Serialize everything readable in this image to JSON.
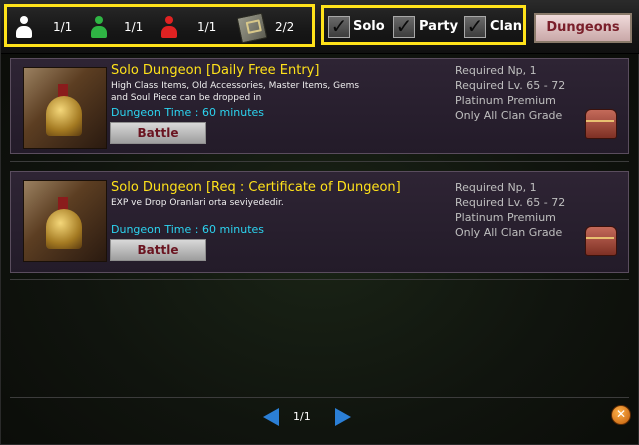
{
  "header": {
    "counts": [
      {
        "color": "#ffffff",
        "value": "1/1"
      },
      {
        "color": "#2fb544",
        "value": "1/1"
      },
      {
        "color": "#e02222",
        "value": "1/1"
      },
      {
        "icon": "letter-icon",
        "value": "2/2"
      }
    ],
    "filters": [
      {
        "label": "Solo",
        "checked": true
      },
      {
        "label": "Party",
        "checked": true
      },
      {
        "label": "Clan",
        "checked": true
      }
    ],
    "dungeons_label": "Dungeons"
  },
  "dungeons": [
    {
      "title": "Solo Dungeon [Daily Free Entry]",
      "description": "High Class Items, Old Accessories, Master Items, Gems and Soul Piece can be dropped in",
      "time": "Dungeon Time : 60 minutes",
      "battle_label": "Battle",
      "requirements": [
        "Required Np, 1",
        "Required Lv. 65 - 72",
        "Platinum Premium",
        "Only All Clan Grade"
      ]
    },
    {
      "title": "Solo Dungeon [Req : Certificate of Dungeon]",
      "description": "EXP ve Drop Oranlari orta seviyededir.",
      "time": "Dungeon Time : 60 minutes",
      "battle_label": "Battle",
      "requirements": [
        "Required Np, 1",
        "Required Lv. 65 - 72",
        "Platinum Premium",
        "Only All Clan Grade"
      ]
    }
  ],
  "pager": {
    "page": "1/1"
  },
  "colors": {
    "highlight": "#ffe21a",
    "title": "#ffe21a",
    "time": "#2cd4f0",
    "battle_text": "#6a1420"
  }
}
